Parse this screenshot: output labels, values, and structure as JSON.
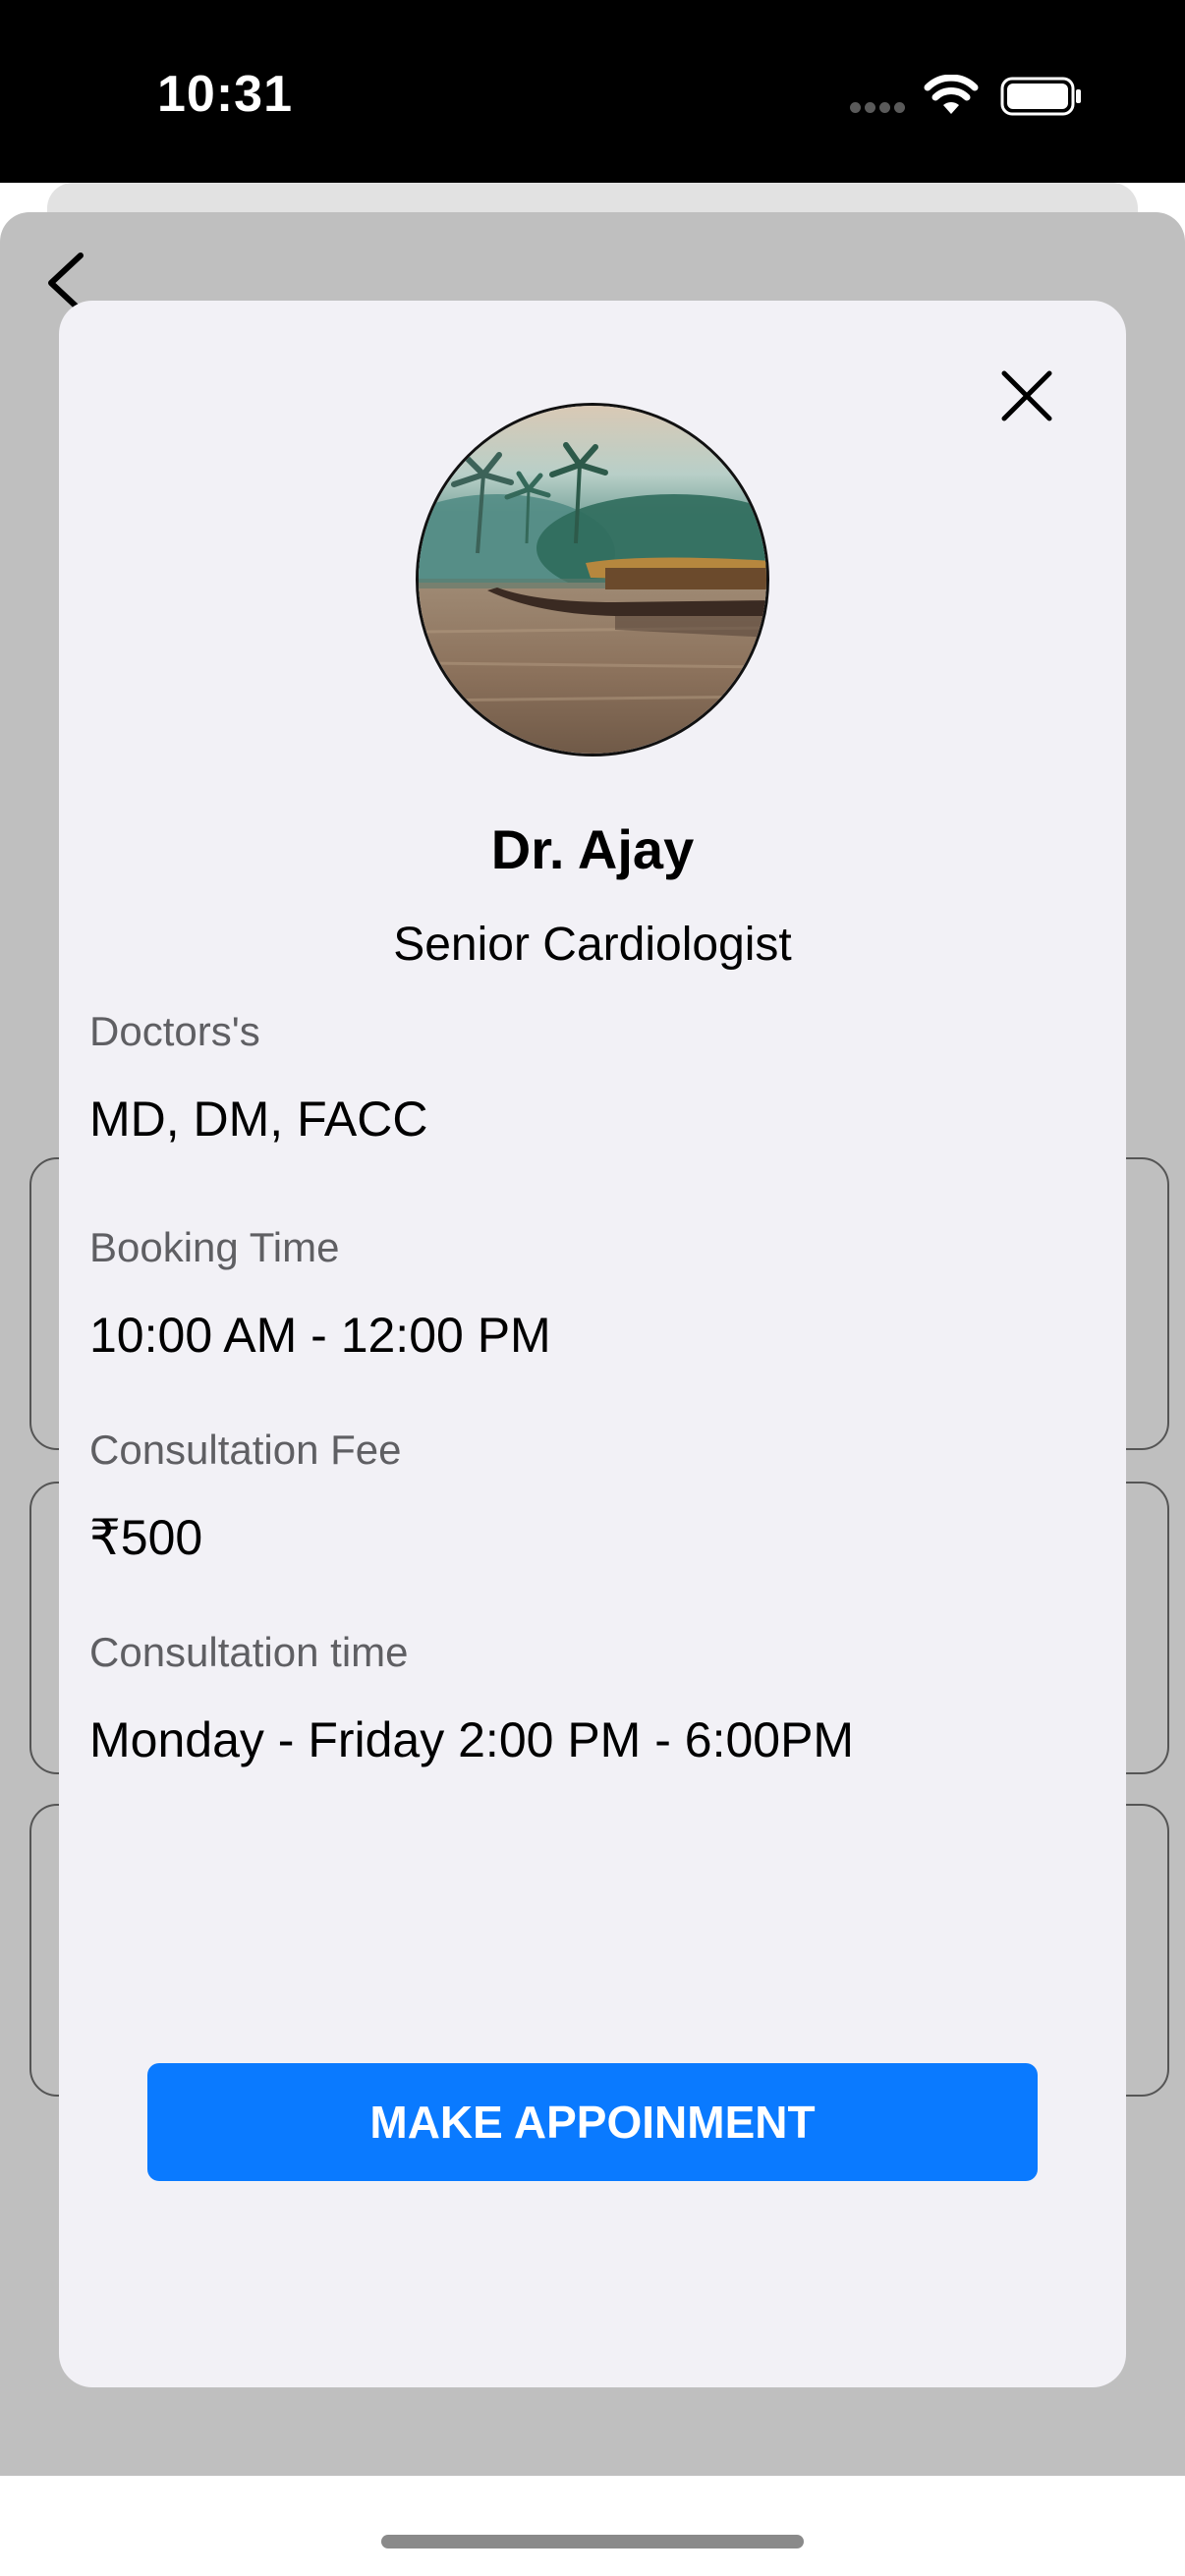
{
  "status_bar": {
    "time": "10:31",
    "icons": [
      "signal-dots-icon",
      "wifi-icon",
      "battery-icon"
    ]
  },
  "navigation": {
    "back_icon": "chevron-left-icon"
  },
  "doctor_modal": {
    "close_icon": "close-icon",
    "avatar_image": "backwaters-houseboat-photo",
    "name": "Dr. Ajay",
    "title": "Senior Cardiologist",
    "fields": [
      {
        "label": "Doctors's",
        "value": "MD, DM, FACC"
      },
      {
        "label": "Booking Time",
        "value": "10:00 AM - 12:00 PM"
      },
      {
        "label": "Consultation Fee",
        "value": "₹500"
      },
      {
        "label": "Consultation time",
        "value": "Monday - Friday 2:00 PM - 6:00PM"
      }
    ],
    "action_button_label": "MAKE APPOINMENT"
  },
  "colors": {
    "status_bar_bg": "#000000",
    "backdrop": "#bfbfbf",
    "modal_bg": "#f2f1f6",
    "primary_button": "#0a7aff",
    "label_gray": "#5f5f63"
  }
}
